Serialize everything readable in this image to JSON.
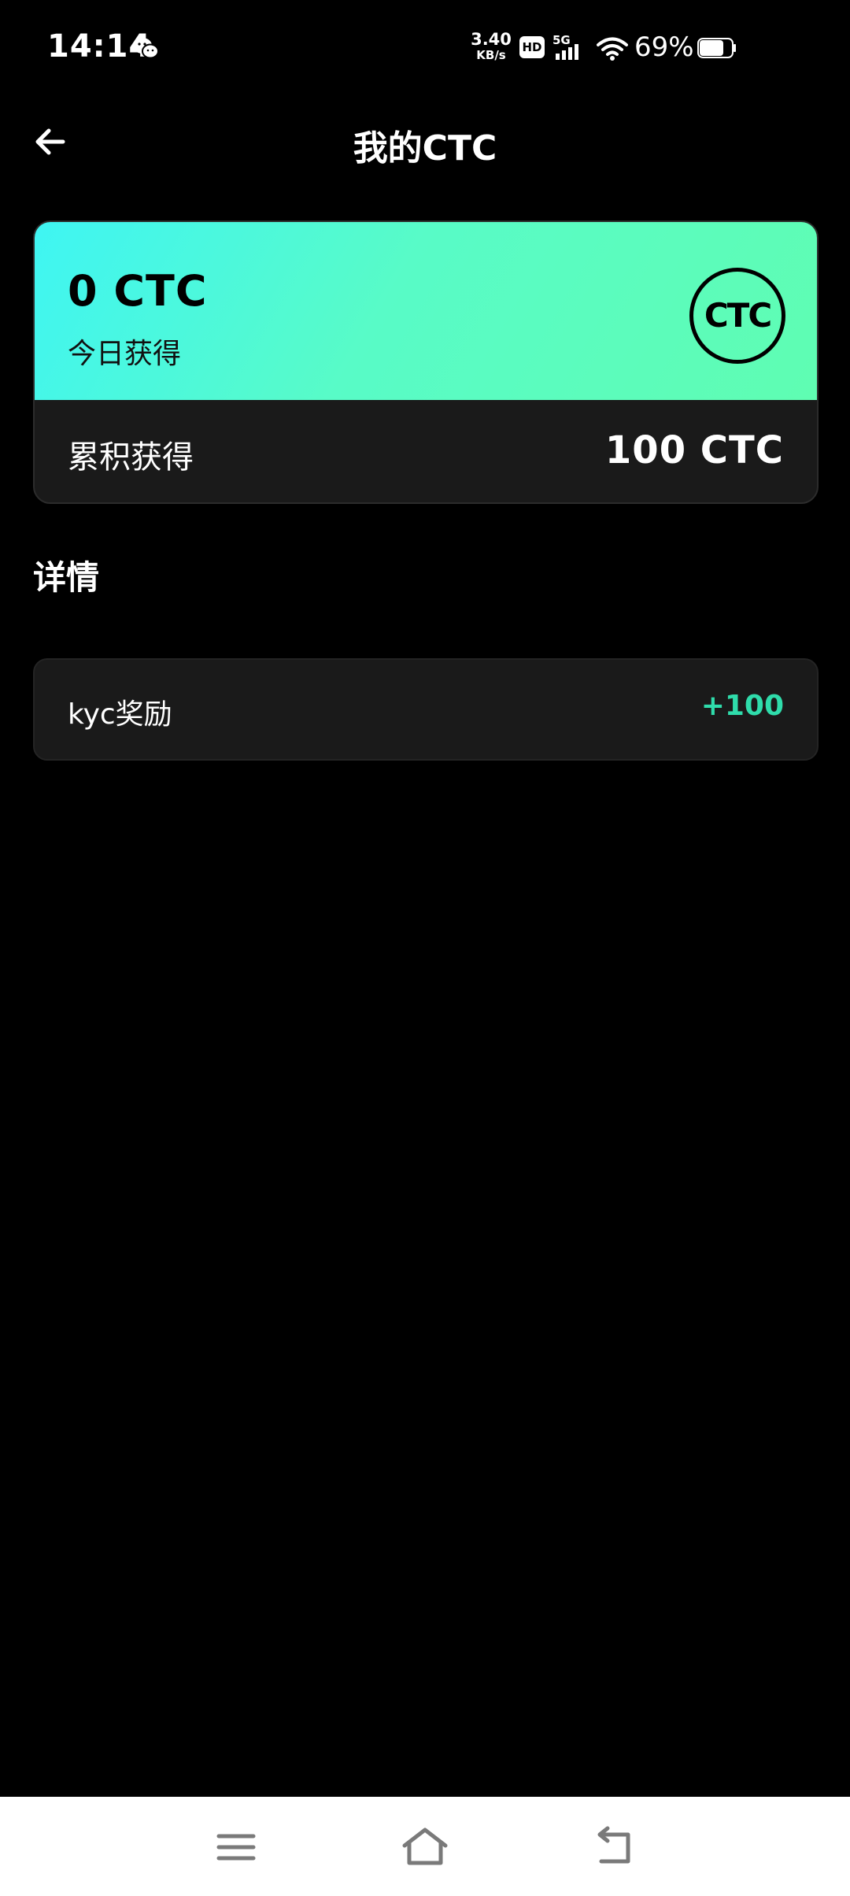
{
  "status_bar": {
    "time": "14:14",
    "net_speed_value": "3.40",
    "net_speed_unit": "KB/s",
    "hd": "HD",
    "network": "5G",
    "battery": "69%"
  },
  "header": {
    "title": "我的CTC"
  },
  "balance": {
    "today_amount": "0 CTC",
    "today_label": "今日获得",
    "logo_text": "CTC",
    "total_label": "累积获得",
    "total_amount": "100 CTC"
  },
  "details": {
    "section_title": "详情",
    "items": [
      {
        "label": "kyc奖励",
        "value": "+100"
      }
    ]
  },
  "colors": {
    "background": "#000000",
    "card_gradient_start": "#3ff5f3",
    "card_gradient_end": "#5ffdb2",
    "positive_value": "#2fdcab",
    "card_dark": "#1a1a1a"
  },
  "icons": {
    "back": "arrow-left-icon",
    "wechat": "wechat-icon",
    "wifi": "wifi-icon",
    "battery": "battery-icon",
    "nav_menu": "menu-icon",
    "nav_home": "home-icon",
    "nav_back": "back-icon"
  }
}
